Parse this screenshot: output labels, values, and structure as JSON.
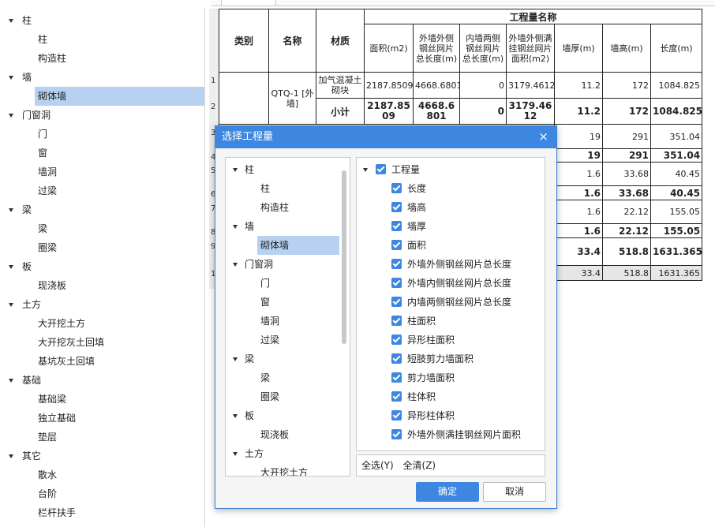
{
  "left_tree": [
    {
      "label": "柱",
      "level": 0
    },
    {
      "label": "柱",
      "level": 1
    },
    {
      "label": "构造柱",
      "level": 1
    },
    {
      "label": "墙",
      "level": 0
    },
    {
      "label": "砌体墙",
      "level": 1,
      "selected": true
    },
    {
      "label": "门窗洞",
      "level": 0
    },
    {
      "label": "门",
      "level": 1
    },
    {
      "label": "窗",
      "level": 1
    },
    {
      "label": "墙洞",
      "level": 1
    },
    {
      "label": "过梁",
      "level": 1
    },
    {
      "label": "梁",
      "level": 0
    },
    {
      "label": "梁",
      "level": 1
    },
    {
      "label": "圈梁",
      "level": 1
    },
    {
      "label": "板",
      "level": 0
    },
    {
      "label": "现浇板",
      "level": 1
    },
    {
      "label": "土方",
      "level": 0
    },
    {
      "label": "大开挖土方",
      "level": 1
    },
    {
      "label": "大开挖灰土回填",
      "level": 1
    },
    {
      "label": "基坑灰土回填",
      "level": 1
    },
    {
      "label": "基础",
      "level": 0
    },
    {
      "label": "基础梁",
      "level": 1
    },
    {
      "label": "独立基础",
      "level": 1
    },
    {
      "label": "垫层",
      "level": 1
    },
    {
      "label": "其它",
      "level": 0
    },
    {
      "label": "散水",
      "level": 1
    },
    {
      "label": "台阶",
      "level": 1
    },
    {
      "label": "栏杆扶手",
      "level": 1
    }
  ],
  "table": {
    "group_header": "工程量名称",
    "headers": {
      "category": "类别",
      "name": "名称",
      "material": "材质",
      "area": "面积(m2)",
      "outer_len": "外墙外侧钢丝网片总长度(m)",
      "inner_len": "内墙两侧钢丝网片总长度(m)",
      "outer_area": "外墙外侧满挂钢丝网片面积(m2)",
      "thickness": "墙厚(m)",
      "height": "墙高(m)",
      "length": "长度(m)"
    },
    "name_cell": "QTQ-1 [外墙]",
    "material_cell": "加气混凝土砌块",
    "subtotal_label": "小计",
    "row_numbers": [
      "1",
      "2",
      "3",
      "4",
      "5",
      "6",
      "7",
      "8",
      "9",
      "1"
    ],
    "row1": {
      "area": "2187.8509",
      "outer_len": "4668.6801",
      "inner_len": "0",
      "outer_area": "3179.4612",
      "thickness": "11.2",
      "height": "172",
      "length": "1084.825"
    },
    "row2": {
      "area": "2187.8509",
      "outer_len": "4668.6801",
      "inner_len": "0",
      "outer_area": "3179.4612",
      "thickness": "11.2",
      "height": "172",
      "length": "1084.825"
    },
    "row3": {
      "thickness": "19",
      "height": "291",
      "length": "351.04"
    },
    "row4": {
      "thickness": "19",
      "height": "291",
      "length": "351.04"
    },
    "row5": {
      "thickness": "1.6",
      "height": "33.68",
      "length": "40.45"
    },
    "row6": {
      "thickness": "1.6",
      "height": "33.68",
      "length": "40.45"
    },
    "row7": {
      "thickness": "1.6",
      "height": "22.12",
      "length": "155.05"
    },
    "row8": {
      "thickness": "1.6",
      "height": "22.12",
      "length": "155.05"
    },
    "row9": {
      "thickness": "33.4",
      "height": "518.8",
      "length": "1631.365"
    },
    "row10": {
      "thickness": "33.4",
      "height": "518.8",
      "length": "1631.365"
    }
  },
  "dialog": {
    "title": "选择工程量",
    "close_glyph": "×",
    "tree": [
      {
        "label": "柱",
        "level": 0
      },
      {
        "label": "柱",
        "level": 1
      },
      {
        "label": "构造柱",
        "level": 1
      },
      {
        "label": "墙",
        "level": 0
      },
      {
        "label": "砌体墙",
        "level": 1,
        "selected": true
      },
      {
        "label": "门窗洞",
        "level": 0
      },
      {
        "label": "门",
        "level": 1
      },
      {
        "label": "窗",
        "level": 1
      },
      {
        "label": "墙洞",
        "level": 1
      },
      {
        "label": "过梁",
        "level": 1
      },
      {
        "label": "梁",
        "level": 0
      },
      {
        "label": "梁",
        "level": 1
      },
      {
        "label": "圈梁",
        "level": 1
      },
      {
        "label": "板",
        "level": 0
      },
      {
        "label": "现浇板",
        "level": 1
      },
      {
        "label": "土方",
        "level": 0
      },
      {
        "label": "大开挖土方",
        "level": 1
      }
    ],
    "checks_root": "工程量",
    "checks": [
      "长度",
      "墙高",
      "墙厚",
      "面积",
      "外墙外侧钢丝网片总长度",
      "外墙内侧钢丝网片总长度",
      "内墙两侧钢丝网片总长度",
      "柱面积",
      "异形柱面积",
      "短肢剪力墙面积",
      "剪力墙面积",
      "柱体积",
      "异形柱体积",
      "外墙外侧满挂钢丝网片面积"
    ],
    "select_all": "全选(Y)",
    "clear_all": "全清(Z)",
    "ok": "确定",
    "cancel": "取消"
  },
  "colors": {
    "accent": "#3d87e0",
    "selection": "#b7d1f0"
  }
}
